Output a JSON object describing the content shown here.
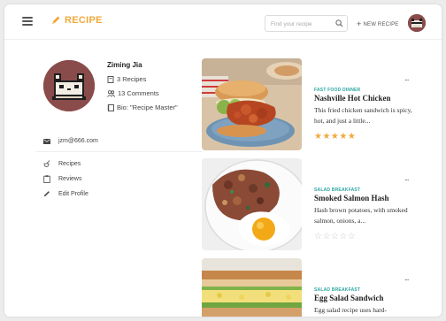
{
  "app": {
    "brand": "RECIPE",
    "accent": "#f2a93b",
    "teal": "#2aa5a0"
  },
  "header": {
    "search_placeholder": "Find your recipe",
    "new_recipe_label": "NEW RECIPE"
  },
  "profile": {
    "name": "Ziming Jia",
    "recipes": "3 Recipes",
    "comments": "13 Comments",
    "bio": "Bio: \"Recipe Master\"",
    "email": "jzm@666.com"
  },
  "nav": [
    {
      "label": "Recipes",
      "icon": "cooking-icon"
    },
    {
      "label": "Reviews",
      "icon": "clipboard-icon"
    },
    {
      "label": "Edit Profile",
      "icon": "pencil-icon"
    }
  ],
  "cards": [
    {
      "category": "FAST FOOD DINNER",
      "title": "Nashville Hot Chicken",
      "description": "This fried chicken sandwich is spicy, hot, and just a little...",
      "rating": 5,
      "stars": "★★★★★"
    },
    {
      "category": "SALAD BREAKFAST",
      "title": "Smoked Salmon Hash",
      "description": "Hash brown potatoes, with smoked salmon, onions, a...",
      "rating": 0,
      "stars": "☆☆☆☆☆"
    },
    {
      "category": "SALAD BREAKFAST",
      "title": "Egg Salad Sandwich",
      "description": "Egg salad recipe uses hard-"
    }
  ],
  "more_label": "..."
}
